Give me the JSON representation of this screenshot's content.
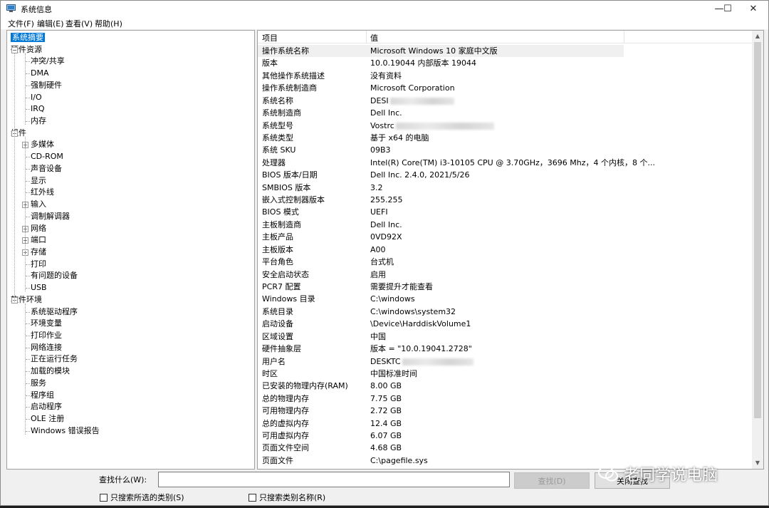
{
  "window": {
    "title": "系统信息",
    "controls": {
      "minimize": "—",
      "maximize": "☐",
      "close": "✕"
    }
  },
  "menu": [
    {
      "label": "文件(F)"
    },
    {
      "label": "编辑(E)"
    },
    {
      "label": "查看(V)"
    },
    {
      "label": "帮助(H)"
    }
  ],
  "tree": [
    {
      "label": "系统摘要",
      "level": 0,
      "expander": "",
      "selected": true
    },
    {
      "label": "硬件资源",
      "level": 0,
      "expander": "−"
    },
    {
      "label": "冲突/共享",
      "level": 1,
      "expander": ""
    },
    {
      "label": "DMA",
      "level": 1,
      "expander": ""
    },
    {
      "label": "强制硬件",
      "level": 1,
      "expander": ""
    },
    {
      "label": "I/O",
      "level": 1,
      "expander": ""
    },
    {
      "label": "IRQ",
      "level": 1,
      "expander": ""
    },
    {
      "label": "内存",
      "level": 1,
      "expander": ""
    },
    {
      "label": "组件",
      "level": 0,
      "expander": "−"
    },
    {
      "label": "多媒体",
      "level": 1,
      "expander": "+"
    },
    {
      "label": "CD-ROM",
      "level": 1,
      "expander": ""
    },
    {
      "label": "声音设备",
      "level": 1,
      "expander": ""
    },
    {
      "label": "显示",
      "level": 1,
      "expander": ""
    },
    {
      "label": "红外线",
      "level": 1,
      "expander": ""
    },
    {
      "label": "输入",
      "level": 1,
      "expander": "+"
    },
    {
      "label": "调制解调器",
      "level": 1,
      "expander": ""
    },
    {
      "label": "网络",
      "level": 1,
      "expander": "+"
    },
    {
      "label": "端口",
      "level": 1,
      "expander": "+"
    },
    {
      "label": "存储",
      "level": 1,
      "expander": "+"
    },
    {
      "label": "打印",
      "level": 1,
      "expander": ""
    },
    {
      "label": "有问题的设备",
      "level": 1,
      "expander": ""
    },
    {
      "label": "USB",
      "level": 1,
      "expander": ""
    },
    {
      "label": "软件环境",
      "level": 0,
      "expander": "−"
    },
    {
      "label": "系统驱动程序",
      "level": 1,
      "expander": ""
    },
    {
      "label": "环境变量",
      "level": 1,
      "expander": ""
    },
    {
      "label": "打印作业",
      "level": 1,
      "expander": ""
    },
    {
      "label": "网络连接",
      "level": 1,
      "expander": ""
    },
    {
      "label": "正在运行任务",
      "level": 1,
      "expander": ""
    },
    {
      "label": "加载的模块",
      "level": 1,
      "expander": ""
    },
    {
      "label": "服务",
      "level": 1,
      "expander": ""
    },
    {
      "label": "程序组",
      "level": 1,
      "expander": ""
    },
    {
      "label": "启动程序",
      "level": 1,
      "expander": ""
    },
    {
      "label": "OLE 注册",
      "level": 1,
      "expander": ""
    },
    {
      "label": "Windows 错误报告",
      "level": 1,
      "expander": ""
    }
  ],
  "list": {
    "columns": [
      "项目",
      "值"
    ],
    "rows": [
      {
        "item": "操作系统名称",
        "value": "Microsoft Windows 10 家庭中文版",
        "highlight": true
      },
      {
        "item": "版本",
        "value": "10.0.19044 内部版本 19044"
      },
      {
        "item": "其他操作系统描述",
        "value": "没有资料"
      },
      {
        "item": "操作系统制造商",
        "value": "Microsoft Corporation"
      },
      {
        "item": "系统名称",
        "value": "DESI",
        "blurred": 90
      },
      {
        "item": "系统制造商",
        "value": "Dell Inc."
      },
      {
        "item": "系统型号",
        "value": "Vostrc",
        "blurred": 138
      },
      {
        "item": "系统类型",
        "value": "基于 x64 的电脑"
      },
      {
        "item": "系统 SKU",
        "value": "09B3"
      },
      {
        "item": "处理器",
        "value": "Intel(R) Core(TM) i3-10105 CPU @ 3.70GHz，3696 Mhz，4 个内核，8 个..."
      },
      {
        "item": "BIOS 版本/日期",
        "value": "Dell Inc. 2.4.0, 2021/5/26"
      },
      {
        "item": "SMBIOS 版本",
        "value": "3.2"
      },
      {
        "item": "嵌入式控制器版本",
        "value": "255.255"
      },
      {
        "item": "BIOS 模式",
        "value": "UEFI"
      },
      {
        "item": "主板制造商",
        "value": "Dell Inc."
      },
      {
        "item": "主板产品",
        "value": "0VD92X"
      },
      {
        "item": "主板版本",
        "value": "A00"
      },
      {
        "item": "平台角色",
        "value": "台式机"
      },
      {
        "item": "安全启动状态",
        "value": "启用"
      },
      {
        "item": "PCR7 配置",
        "value": "需要提升才能查看"
      },
      {
        "item": "Windows 目录",
        "value": "C:\\windows"
      },
      {
        "item": "系统目录",
        "value": "C:\\windows\\system32"
      },
      {
        "item": "启动设备",
        "value": "\\Device\\HarddiskVolume1"
      },
      {
        "item": "区域设置",
        "value": "中国"
      },
      {
        "item": "硬件抽象层",
        "value": "版本 = \"10.0.19041.2728\""
      },
      {
        "item": "用户名",
        "value": "DESKTC",
        "blurred": 100
      },
      {
        "item": "时区",
        "value": "中国标准时间"
      },
      {
        "item": "已安装的物理内存(RAM)",
        "value": "8.00 GB"
      },
      {
        "item": "总的物理内存",
        "value": "7.75 GB"
      },
      {
        "item": "可用物理内存",
        "value": "2.72 GB"
      },
      {
        "item": "总的虚拟内存",
        "value": "12.4 GB"
      },
      {
        "item": "可用虚拟内存",
        "value": "6.07 GB"
      },
      {
        "item": "页面文件空间",
        "value": "4.68 GB"
      },
      {
        "item": "页面文件",
        "value": "C:\\pagefile.sys"
      }
    ]
  },
  "find": {
    "label": "查找什么(W):",
    "value": "",
    "find_button": "查找(D)",
    "close_button": "关闭查找",
    "chk_selected_only": "只搜索所选的类别(S)",
    "chk_category_names": "只搜索类别名称(R)"
  },
  "watermark": {
    "text": "老同学说电脑"
  },
  "colors": {
    "selection": "#0078d7",
    "window_bg": "#f0f0f0"
  }
}
